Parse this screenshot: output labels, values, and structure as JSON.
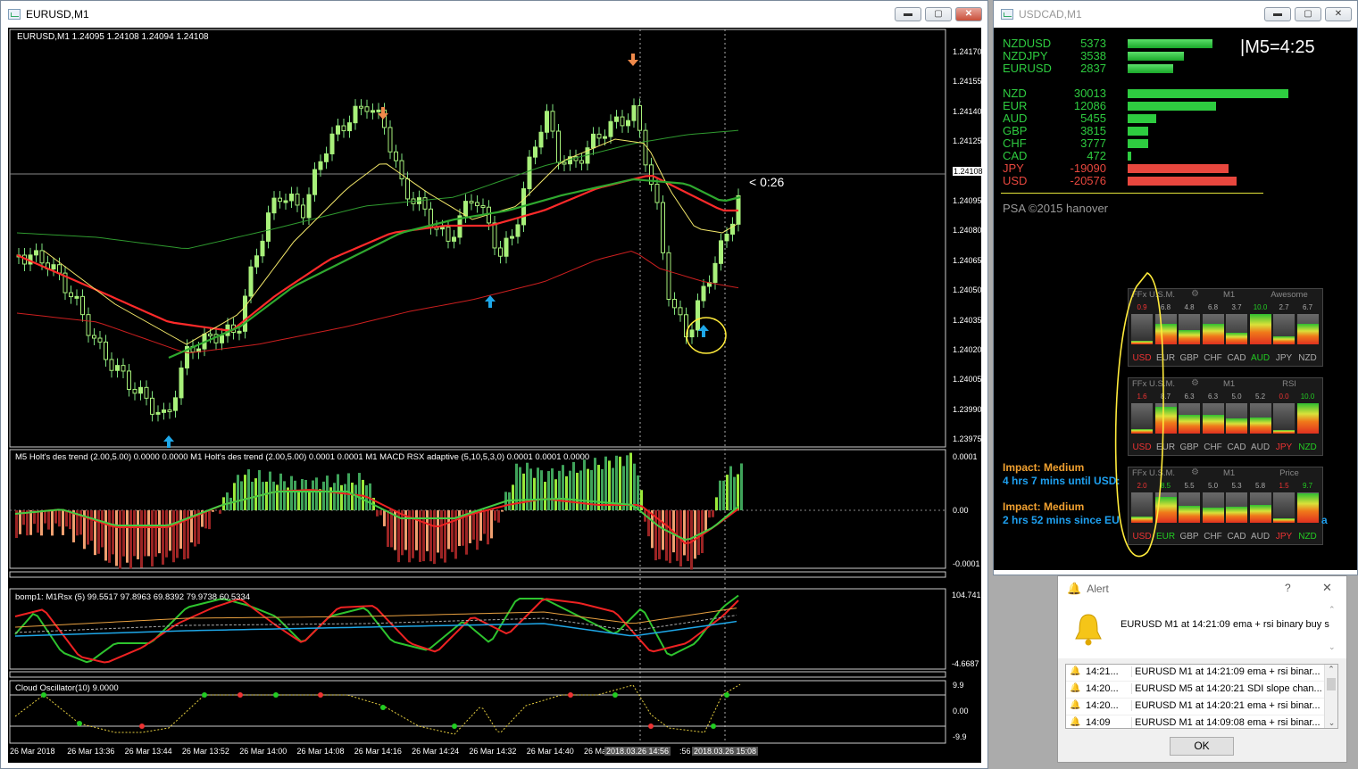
{
  "main_window": {
    "title": "EURUSD,M1",
    "btn_min": "▬",
    "btn_max": "▢",
    "btn_close": "✕"
  },
  "chart": {
    "header": "EURUSD,M1  1.24095 1.24108 1.24094 1.24108",
    "price_labels": [
      "1.24170",
      "1.24155",
      "1.24140",
      "1.24125",
      "1.24108",
      "1.24095",
      "1.24080",
      "1.24065",
      "1.24050",
      "1.24035",
      "1.24020",
      "1.24005",
      "1.23990",
      "1.23975"
    ],
    "countdown": "< 0:26",
    "ind1_header": "M5 Holt's des trend (2.00,5.00) 0.0000 0.0000  M1 Holt's des trend (2.00,5.00) 0.0001 0.0001  M1 MACD RSX adaptive (5,10,5,3,0) 0.0001 0.0001 0.0000",
    "ind1_labels": [
      "0.0001",
      "0.00",
      "-0.0001"
    ],
    "ind2_header": "bomp1: M1Rsx (5) 99.5517 97.8963 69.8392 79.9738 60.5334",
    "ind2_labels": [
      "104.7416",
      "-4.6687"
    ],
    "ind3_header": "Cloud Oscillator(10) 9.0000",
    "ind3_labels": [
      "9.9",
      "0.00",
      "-9.9"
    ],
    "time_labels": [
      "26 Mar 2018",
      "26 Mar 13:36",
      "26 Mar 13:44",
      "26 Mar 13:52",
      "26 Mar 14:00",
      "26 Mar 14:08",
      "26 Mar 14:16",
      "26 Mar 14:24",
      "26 Mar 14:32",
      "26 Mar 14:40",
      "26 Ma"
    ],
    "time_box_1": "2018.03.26 14:56",
    "time_box_2": "2018.03.26 15:08",
    "time_partial": ":56"
  },
  "side_window": {
    "title": "USDCAD,M1",
    "btn_min": "▬",
    "btn_max": "▢",
    "btn_close": "✕"
  },
  "strength": {
    "timer": "|M5=4:25",
    "pairs": [
      {
        "name": "NZDUSD",
        "value": "5373",
        "fill": 0.78
      },
      {
        "name": "NZDJPY",
        "value": "3538",
        "fill": 0.52
      },
      {
        "name": "EURUSD",
        "value": "2837",
        "fill": 0.42
      }
    ],
    "currencies": [
      {
        "name": "NZD",
        "value": "30013",
        "fill": 1.0,
        "color": "#2ecc40"
      },
      {
        "name": "EUR",
        "value": "12086",
        "fill": 0.55,
        "color": "#2ecc40"
      },
      {
        "name": "AUD",
        "value": "5455",
        "fill": 0.18,
        "color": "#2ecc40"
      },
      {
        "name": "GBP",
        "value": "3815",
        "fill": 0.13,
        "color": "#2ecc40"
      },
      {
        "name": "CHF",
        "value": "3777",
        "fill": 0.13,
        "color": "#2ecc40"
      },
      {
        "name": "CAD",
        "value": "472",
        "fill": 0.02,
        "color": "#2ecc40"
      },
      {
        "name": "JPY",
        "value": "-19090",
        "fill": 0.63,
        "color": "#e8473e"
      },
      {
        "name": "USD",
        "value": "-20576",
        "fill": 0.68,
        "color": "#e8473e"
      }
    ],
    "copyright": "PSA ©2015 hanover"
  },
  "ffx_panels": [
    {
      "h1": "FFx U.S.M.",
      "h2": "M1",
      "h3": "Awesome",
      "vals": [
        "0.9",
        "6.8",
        "4.8",
        "6.8",
        "3.7",
        "10.0",
        "2.7",
        "6.7"
      ],
      "vcol": [
        "#e33",
        "#aaa",
        "#aaa",
        "#aaa",
        "#aaa",
        "#2c2",
        "#aaa",
        "#aaa"
      ],
      "lvl": [
        0.12,
        0.68,
        0.48,
        0.68,
        0.37,
        1.0,
        0.27,
        0.67
      ],
      "ccol": [
        "#e33",
        "#aaa",
        "#aaa",
        "#aaa",
        "#aaa",
        "#2c2",
        "#aaa",
        "#aaa"
      ]
    },
    {
      "h1": "FFx U.S.M.",
      "h2": "M1",
      "h3": "RSI",
      "vals": [
        "1.6",
        "8.7",
        "6.3",
        "6.3",
        "5.0",
        "5.2",
        "0.0",
        "10.0"
      ],
      "vcol": [
        "#e33",
        "#aaa",
        "#aaa",
        "#aaa",
        "#aaa",
        "#aaa",
        "#e33",
        "#2c2"
      ],
      "lvl": [
        0.16,
        0.87,
        0.63,
        0.63,
        0.5,
        0.52,
        0.02,
        1.0
      ],
      "ccol": [
        "#e33",
        "#aaa",
        "#aaa",
        "#aaa",
        "#aaa",
        "#aaa",
        "#e33",
        "#2c2"
      ]
    },
    {
      "h1": "FFx U.S.M.",
      "h2": "M1",
      "h3": "Price",
      "vals": [
        "2.0",
        "8.5",
        "5.5",
        "5.0",
        "5.3",
        "5.8",
        "1.5",
        "9.7"
      ],
      "vcol": [
        "#e33",
        "#2c2",
        "#aaa",
        "#aaa",
        "#aaa",
        "#aaa",
        "#e33",
        "#2c2"
      ],
      "lvl": [
        0.2,
        0.85,
        0.55,
        0.5,
        0.53,
        0.58,
        0.15,
        0.97
      ],
      "ccol": [
        "#e33",
        "#2c2",
        "#aaa",
        "#aaa",
        "#aaa",
        "#aaa",
        "#e33",
        "#2c2"
      ]
    }
  ],
  "ffx_currencies": [
    "USD",
    "EUR",
    "GBP",
    "CHF",
    "CAD",
    "AUD",
    "JPY",
    "NZD"
  ],
  "news": {
    "impact1": "Impact: Medium",
    "time1": "4 hrs 7 mins until USD:",
    "impact2": "Impact: Medium",
    "time2": "2 hrs 52 mins since EU",
    "trail": "a"
  },
  "alert": {
    "title": "Alert",
    "help": "?",
    "close": "✕",
    "message": "EURUSD M1 at 14:21:09 ema + rsi binary buy s",
    "rows": [
      {
        "time": "14:21...",
        "text": "EURUSD M1 at 14:21:09 ema + rsi binar..."
      },
      {
        "time": "14:20...",
        "text": "EURUSD M5 at 14:20:21 SDI slope chan..."
      },
      {
        "time": "14:20...",
        "text": "EURUSD M1 at 14:20:21 ema + rsi binar..."
      },
      {
        "time": "14:09",
        "text": "EURUSD M1 at 14:09:08 ema + rsi binar..."
      }
    ],
    "ok": "OK"
  }
}
